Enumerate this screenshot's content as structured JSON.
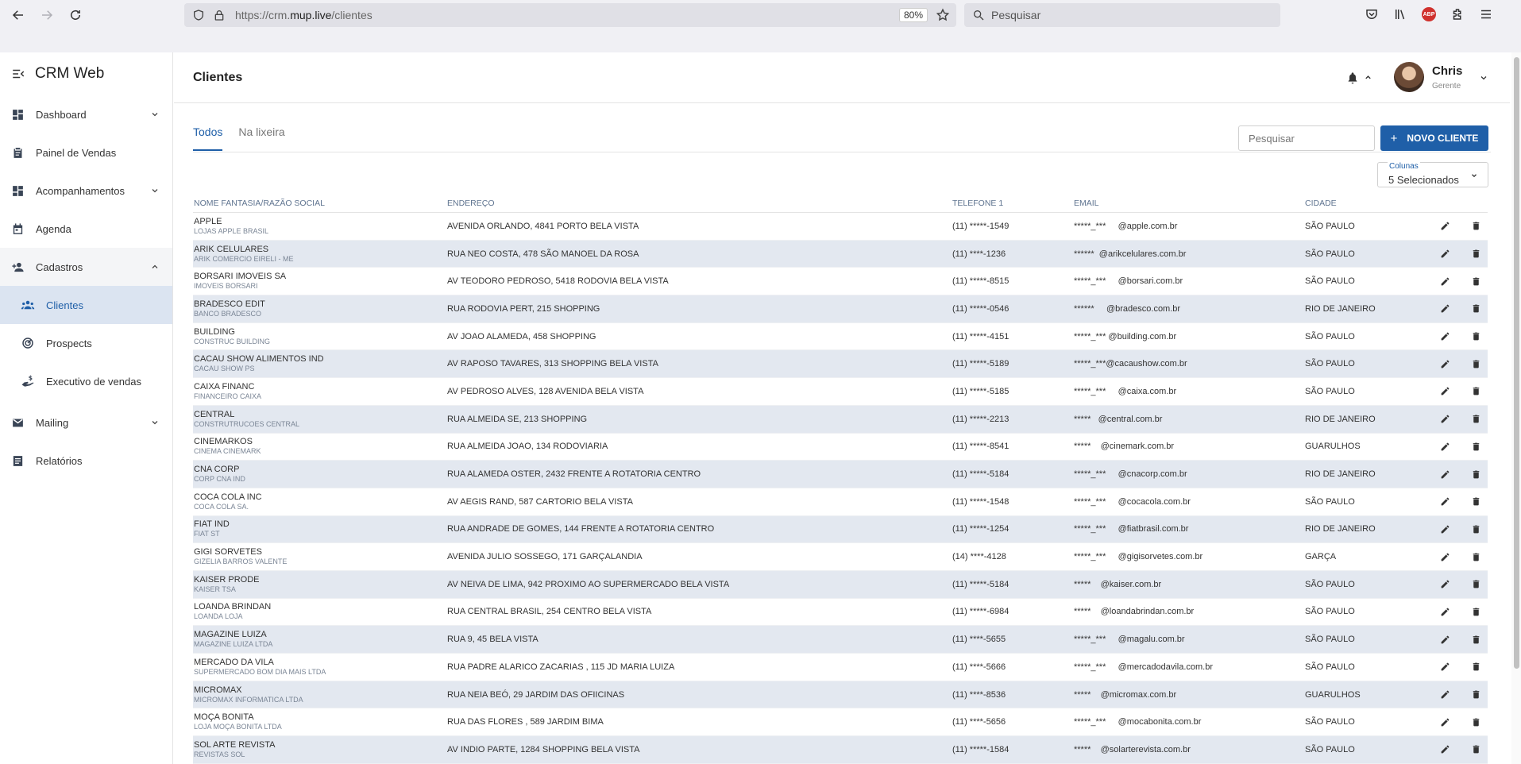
{
  "browser": {
    "url_prefix": "https://crm.",
    "url_domain": "mup.live",
    "url_path": "/clientes",
    "zoom": "80%",
    "search_placeholder": "Pesquisar",
    "abp_label": "ABP"
  },
  "sidebar": {
    "brand": "CRM Web",
    "items": [
      {
        "label": "Dashboard",
        "icon": "dashboard-icon"
      },
      {
        "label": "Painel de Vendas",
        "icon": "clipboard-icon"
      },
      {
        "label": "Acompanhamentos",
        "icon": "dashboard-icon"
      },
      {
        "label": "Agenda",
        "icon": "calendar-icon"
      },
      {
        "label": "Cadastros",
        "icon": "add-user-icon"
      },
      {
        "label": "Clientes",
        "icon": "group-icon"
      },
      {
        "label": "Prospects",
        "icon": "target-icon"
      },
      {
        "label": "Executivo de vendas",
        "icon": "sales-exec-icon"
      },
      {
        "label": "Mailing",
        "icon": "mail-icon"
      },
      {
        "label": "Relatórios",
        "icon": "report-icon"
      }
    ]
  },
  "header": {
    "title": "Clientes",
    "user_name": "Chris",
    "user_role": "Gerente"
  },
  "toolbar": {
    "tabs": [
      "Todos",
      "Na lixeira"
    ],
    "search_placeholder": "Pesquisar",
    "new_button": "NOVO CLIENTE",
    "columns_caption": "Colunas",
    "columns_value": "5 Selecionados"
  },
  "table": {
    "headers": [
      "NOME FANTASIA/RAZÃO SOCIAL",
      "ENDEREÇO",
      "TELEFONE 1",
      "EMAIL",
      "CIDADE"
    ],
    "rows": [
      {
        "name": "APPLE",
        "sub": "LOJAS APPLE BRASIL",
        "addr": "AVENIDA ORLANDO, 4841 PORTO BELA VISTA",
        "tel": "(11) *****-1549",
        "email": "*****_***     @apple.com.br",
        "city": "SÃO PAULO"
      },
      {
        "name": "ARIK CELULARES",
        "sub": "ARIK COMERCIO EIRELI - ME",
        "addr": "RUA NEO COSTA, 478 SÃO MANOEL DA ROSA",
        "tel": "(11) ****-1236",
        "email": "******  @arikcelulares.com.br",
        "city": "SÃO PAULO"
      },
      {
        "name": "BORSARI IMOVEIS SA",
        "sub": "IMOVEIS BORSARI",
        "addr": "AV TEODORO PEDROSO, 5418 RODOVIA BELA VISTA",
        "tel": "(11) *****-8515",
        "email": "*****_***     @borsari.com.br",
        "city": "SÃO PAULO"
      },
      {
        "name": "BRADESCO EDIT",
        "sub": "BANCO BRADESCO",
        "addr": "RUA RODOVIA PERT, 215 SHOPPING",
        "tel": "(11) *****-0546",
        "email": "******     @bradesco.com.br",
        "city": "RIO DE JANEIRO"
      },
      {
        "name": "BUILDING",
        "sub": "CONSTRUC BUILDING",
        "addr": "AV JOAO ALAMEDA, 458 SHOPPING",
        "tel": "(11) *****-4151",
        "email": "*****_*** @building.com.br",
        "city": "SÃO PAULO"
      },
      {
        "name": "CACAU SHOW ALIMENTOS IND",
        "sub": "CACAU SHOW PS",
        "addr": "AV RAPOSO TAVARES, 313 SHOPPING BELA VISTA",
        "tel": "(11) *****-5189",
        "email": "*****_***@cacaushow.com.br",
        "city": "SÃO PAULO"
      },
      {
        "name": "CAIXA FINANC",
        "sub": "FINANCEIRO CAIXA",
        "addr": "AV PEDROSO ALVES, 128 AVENIDA BELA VISTA",
        "tel": "(11) *****-5185",
        "email": "*****_***     @caixa.com.br",
        "city": "SÃO PAULO"
      },
      {
        "name": "CENTRAL",
        "sub": "CONSTRUTRUCOES CENTRAL",
        "addr": "RUA ALMEIDA SE, 213 SHOPPING",
        "tel": "(11) *****-2213",
        "email": "*****   @central.com.br",
        "city": "RIO DE JANEIRO"
      },
      {
        "name": "CINEMARKOS",
        "sub": "CINEMA CINEMARK",
        "addr": "RUA ALMEIDA JOAO, 134 RODOVIARIA",
        "tel": "(11) *****-8541",
        "email": "*****    @cinemark.com.br",
        "city": "GUARULHOS"
      },
      {
        "name": "CNA CORP",
        "sub": "CORP CNA IND",
        "addr": "RUA ALAMEDA OSTER, 2432 FRENTE A ROTATORIA CENTRO",
        "tel": "(11) *****-5184",
        "email": "*****_***     @cnacorp.com.br",
        "city": "RIO DE JANEIRO"
      },
      {
        "name": "COCA COLA INC",
        "sub": "COCA COLA SA.",
        "addr": "AV AEGIS RAND, 587 CARTORIO BELA VISTA",
        "tel": "(11) *****-1548",
        "email": "*****_***     @cocacola.com.br",
        "city": "SÃO PAULO"
      },
      {
        "name": "FIAT IND",
        "sub": "FIAT ST",
        "addr": "RUA ANDRADE DE GOMES, 144 FRENTE A ROTATORIA CENTRO",
        "tel": "(11) *****-1254",
        "email": "*****_***     @fiatbrasil.com.br",
        "city": "RIO DE JANEIRO"
      },
      {
        "name": "GIGI SORVETES",
        "sub": "GIZELIA BARROS VALENTE",
        "addr": "AVENIDA JULIO SOSSEGO, 171 GARÇALANDIA",
        "tel": "(14) ****-4128",
        "email": "*****_***     @gigisorvetes.com.br",
        "city": "GARÇA"
      },
      {
        "name": "KAISER PRODE",
        "sub": "KAISER TSA",
        "addr": "AV NEIVA DE LIMA, 942 PROXIMO AO SUPERMERCADO BELA VISTA",
        "tel": "(11) *****-5184",
        "email": "*****    @kaiser.com.br",
        "city": "SÃO PAULO"
      },
      {
        "name": "LOANDA BRINDAN",
        "sub": "LOANDA LOJA",
        "addr": "RUA CENTRAL BRASIL, 254 CENTRO BELA VISTA",
        "tel": "(11) *****-6984",
        "email": "*****    @loandabrindan.com.br",
        "city": "SÃO PAULO"
      },
      {
        "name": "MAGAZINE LUIZA",
        "sub": "MAGAZINE LUIZA LTDA",
        "addr": "RUA 9, 45 BELA VISTA",
        "tel": "(11) ****-5655",
        "email": "*****_***     @magalu.com.br",
        "city": "SÃO PAULO"
      },
      {
        "name": "MERCADO DA VILA",
        "sub": "SUPERMERCADO BOM DIA MAIS LTDA",
        "addr": "RUA PADRE ALARICO ZACARIAS , 115 JD MARIA LUIZA",
        "tel": "(11) ****-5666",
        "email": "*****_***     @mercadodavila.com.br",
        "city": "SÃO PAULO"
      },
      {
        "name": "MICROMAX",
        "sub": "MICROMAX INFORMATICA LTDA",
        "addr": "RUA NEIA BEÓ, 29 JARDIM DAS OFIICINAS",
        "tel": "(11) ****-8536",
        "email": "*****    @micromax.com.br",
        "city": "GUARULHOS"
      },
      {
        "name": "MOÇA BONITA",
        "sub": "LOJA MOÇA BONITA LTDA",
        "addr": "RUA DAS FLORES , 589 JARDIM BIMA",
        "tel": "(11) ****-5656",
        "email": "*****_***     @mocabonita.com.br",
        "city": "SÃO PAULO"
      },
      {
        "name": "SOL ARTE REVISTA",
        "sub": "REVISTAS SOL",
        "addr": "AV INDIO PARTE, 1284 SHOPPING BELA VISTA",
        "tel": "(11) *****-1584",
        "email": "*****    @solarterevista.com.br",
        "city": "SÃO PAULO"
      }
    ]
  },
  "colors": {
    "accent": "#1f5fa8",
    "row_shade": "#e3e8f0"
  }
}
